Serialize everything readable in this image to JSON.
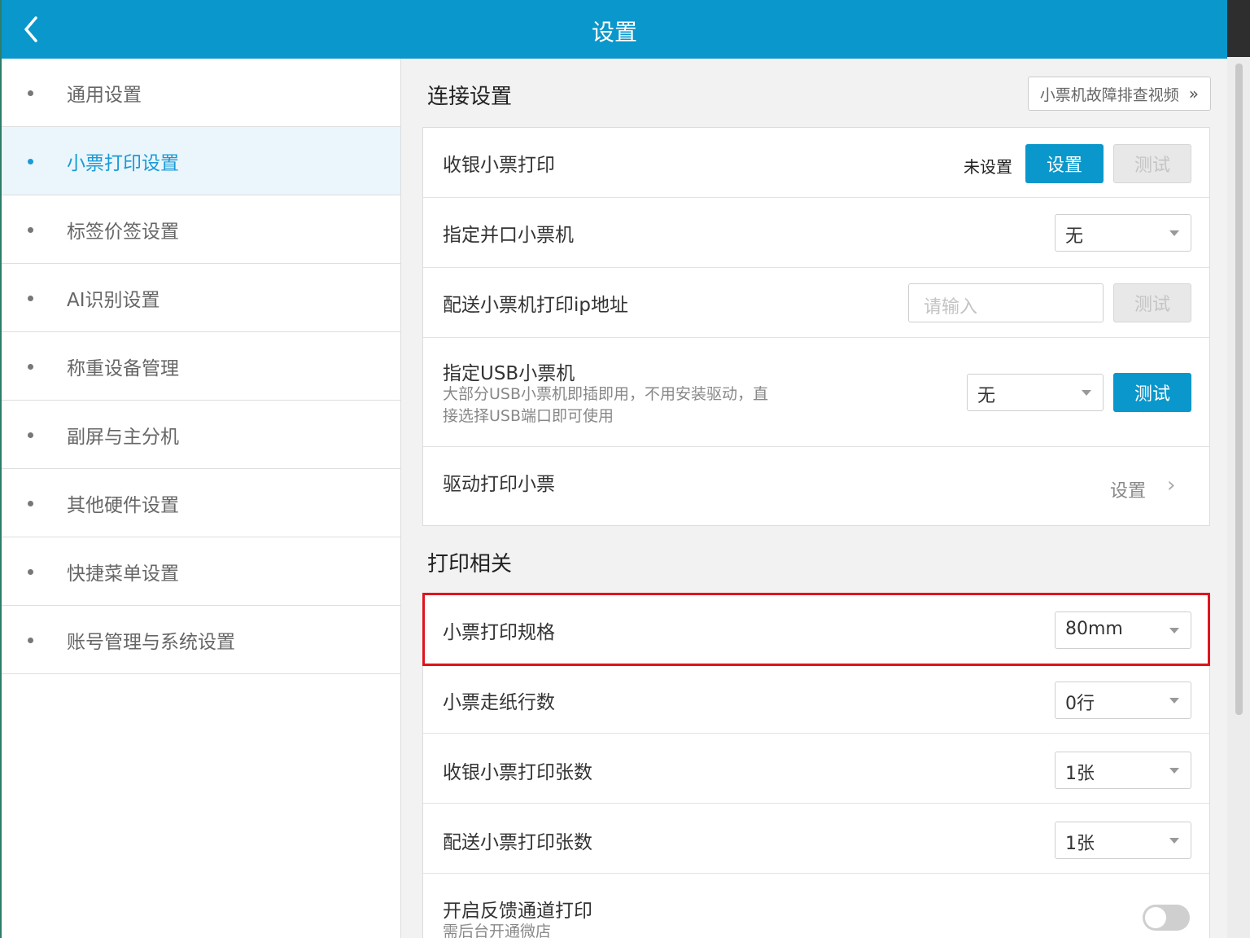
{
  "header": {
    "title": "设置",
    "back_icon": "chevron-left-icon"
  },
  "sidebar": {
    "items": [
      {
        "label": "通用设置",
        "active": false
      },
      {
        "label": "小票打印设置",
        "active": true
      },
      {
        "label": "标签价签设置",
        "active": false
      },
      {
        "label": "AI识别设置",
        "active": false
      },
      {
        "label": "称重设备管理",
        "active": false
      },
      {
        "label": "副屏与主分机",
        "active": false
      },
      {
        "label": "其他硬件设置",
        "active": false
      },
      {
        "label": "快捷菜单设置",
        "active": false
      },
      {
        "label": "账号管理与系统设置",
        "active": false
      }
    ]
  },
  "connection": {
    "title": "连接设置",
    "guide_label": "小票机故障排查视频",
    "rows": {
      "cashier": {
        "label": "收银小票打印",
        "status": "未设置",
        "set_label": "设置",
        "test_label": "测试"
      },
      "parallel": {
        "label": "指定并口小票机",
        "value": "无"
      },
      "delivery_ip": {
        "label": "配送小票机打印ip地址",
        "placeholder": "请输入",
        "test_label": "测试"
      },
      "usb": {
        "label": "指定USB小票机",
        "sub_line1": "大部分USB小票机即插即用，不用安装驱动，直",
        "sub_line2": "接选择USB端口即可使用",
        "value": "无",
        "test_label": "测试"
      },
      "driver": {
        "label": "驱动打印小票",
        "action_label": "设置"
      }
    }
  },
  "printing": {
    "title": "打印相关",
    "rows": {
      "spec": {
        "label": "小票打印规格",
        "value": "80mm"
      },
      "feed": {
        "label": "小票走纸行数",
        "value": "0行"
      },
      "cashier_copies": {
        "label": "收银小票打印张数",
        "value": "1张"
      },
      "delivery_copies": {
        "label": "配送小票打印张数",
        "value": "1张"
      },
      "feedback": {
        "label": "开启反馈通道打印",
        "sub": "需后台开通微店",
        "enabled": false
      }
    }
  },
  "colors": {
    "brand": "#0a97cb",
    "highlight": "#e0141e"
  }
}
